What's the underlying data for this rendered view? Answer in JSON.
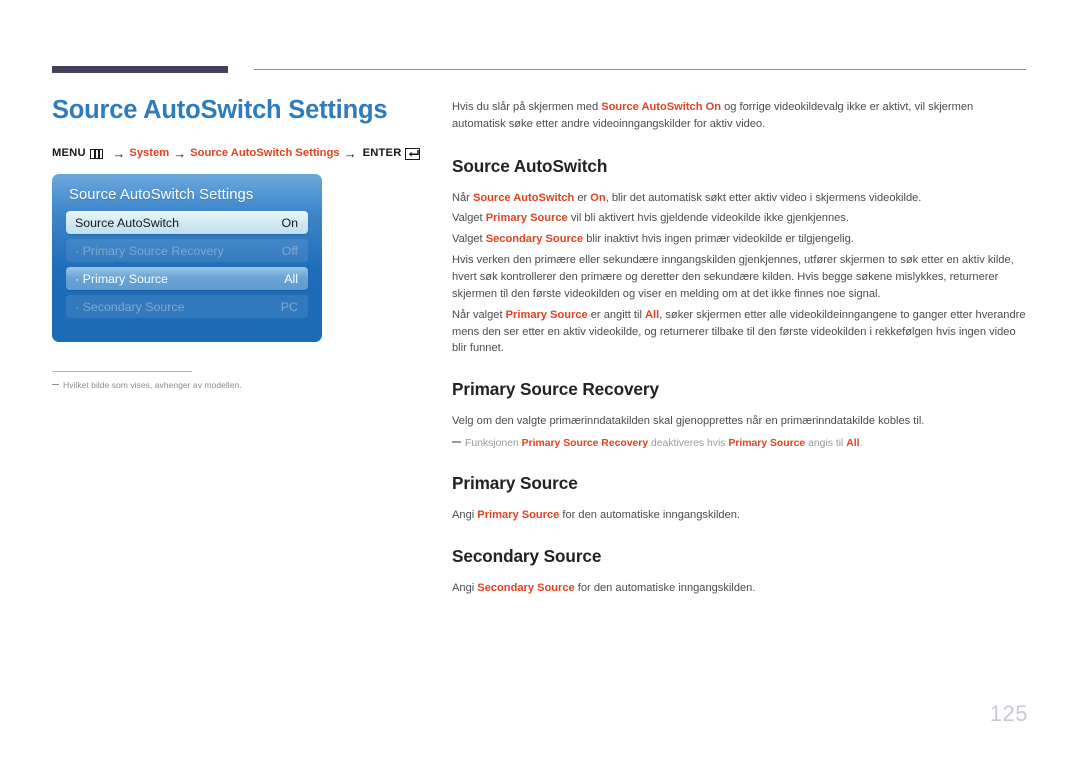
{
  "document": {
    "page_number": "125",
    "title": "Source AutoSwitch Settings"
  },
  "breadcrumb": {
    "menu_label": "MENU",
    "menu_icon": "menu-grid-icon",
    "arrow": "→",
    "step1": "System",
    "step2": "Source AutoSwitch Settings",
    "enter_label": "ENTER",
    "enter_icon": "enter-key-icon"
  },
  "osd": {
    "title": "Source AutoSwitch Settings",
    "rows": [
      {
        "label": "Source AutoSwitch",
        "value": "On",
        "state": "highlight"
      },
      {
        "label": "· Primary Source Recovery",
        "value": "Off",
        "state": "disabled"
      },
      {
        "label": "· Primary Source",
        "value": "All",
        "state": "selected"
      },
      {
        "label": "· Secondary Source",
        "value": "PC",
        "state": "disabled"
      }
    ]
  },
  "left_footnote": {
    "text": "Hvilket bilde som vises, avhenger av modellen."
  },
  "content": {
    "intro": {
      "p1_a": "Hvis du slår på skjermen med ",
      "p1_b": "Source AutoSwitch On",
      "p1_c": " og forrige videokildevalg ikke er aktivt, vil skjermen automatisk søke etter andre videoinngangskilder for aktiv video."
    },
    "sections": [
      {
        "heading": "Source AutoSwitch",
        "paragraphs": [
          {
            "a": "Når ",
            "b1": "Source AutoSwitch",
            "c": " er ",
            "b2": "On",
            "d": ", blir det automatisk søkt etter aktiv video i skjermens videokilde."
          },
          {
            "a": "Valget ",
            "b1": "Primary Source",
            "d": " vil bli aktivert hvis gjeldende videokilde ikke gjenkjennes."
          },
          {
            "a": "Valget ",
            "b1": "Secondary Source",
            "d": " blir inaktivt hvis ingen primær videokilde er tilgjengelig."
          },
          {
            "a": "Hvis verken den primære eller sekundære inngangskilden gjenkjennes, utfører skjermen to søk etter en aktiv kilde, hvert søk kontrollerer den primære og deretter den sekundære kilden. Hvis begge søkene mislykkes, returnerer skjermen til den første videokilden og viser en melding om at det ikke finnes noe signal."
          },
          {
            "a": "Når valget ",
            "b1": "Primary Source",
            "c": " er angitt til ",
            "b2": "All",
            "d": ", søker skjermen etter alle videokildeinngangene to ganger etter hverandre mens den ser etter en aktiv videokilde, og returnerer tilbake til den første videokilden i rekkefølgen hvis ingen video blir funnet."
          }
        ]
      },
      {
        "heading": "Primary Source Recovery",
        "paragraphs": [
          {
            "a": "Velg om den valgte primærinndatakilden skal gjenopprettes når en primærinndatakilde kobles til."
          }
        ],
        "note": {
          "a": "Funksjonen ",
          "b1": "Primary Source Recovery",
          "c": " deaktiveres hvis ",
          "b2": "Primary Source",
          "d": " angis til ",
          "b3": "All",
          "e": "."
        }
      },
      {
        "heading": "Primary Source",
        "paragraphs": [
          {
            "a": "Angi ",
            "b1": "Primary Source",
            "d": " for den automatiske inngangskilden."
          }
        ]
      },
      {
        "heading": "Secondary Source",
        "paragraphs": [
          {
            "a": "Angi ",
            "b1": "Secondary Source",
            "d": " for den automatiske inngangskilden."
          }
        ]
      }
    ]
  },
  "colors": {
    "title_blue": "#2d7cbd",
    "accent_red": "#e1421f",
    "rule_dark": "#453f5c",
    "osd_blue": "#1f6cb8",
    "body_gray": "#4c4c51",
    "page_num_gray": "#c9c9d4"
  }
}
